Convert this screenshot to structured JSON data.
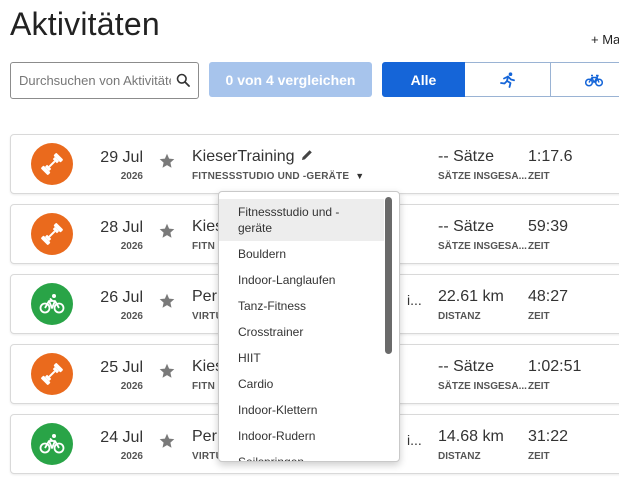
{
  "page": {
    "title": "Aktivitäten",
    "add_manual": "+ Ma"
  },
  "toolbar": {
    "search_placeholder": "Durchsuchen von Aktivitäten",
    "compare_label": "0 von 4 vergleichen",
    "filter_all_label": "Alle",
    "filter_icons": [
      "running-icon",
      "cycling-icon"
    ]
  },
  "colors": {
    "strength_icon_bg": "#ea6a1d",
    "cycling_icon_bg": "#29a447",
    "primary_blue": "#1565d8",
    "compare_disabled": "#a7c4ec"
  },
  "activities": [
    {
      "icon": "strength-icon",
      "day": "29 Jul",
      "year": "2026",
      "name": "KieserTraining",
      "type": "FITNESSSTUDIO UND -GERÄTE",
      "metric1_value": "-- Sätze",
      "metric1_label": "SÄTZE INSGESA...",
      "metric2_value": "1:17.6",
      "metric2_label": "ZEIT"
    },
    {
      "icon": "strength-icon",
      "day": "28 Jul",
      "year": "2026",
      "name": "Kies",
      "type": "FITN",
      "metric1_value": "-- Sätze",
      "metric1_label": "SÄTZE INSGESA...",
      "metric2_value": "59:39",
      "metric2_label": "ZEIT"
    },
    {
      "icon": "cycling-icon",
      "day": "26 Jul",
      "year": "2026",
      "name": "Per",
      "type": "VIRTU",
      "ellipsis": "i...",
      "metric1_value": "22.61 km",
      "metric1_label": "DISTANZ",
      "metric2_value": "48:27",
      "metric2_label": "ZEIT"
    },
    {
      "icon": "strength-icon",
      "day": "25 Jul",
      "year": "2026",
      "name": "Kies",
      "type": "FITN",
      "metric1_value": "-- Sätze",
      "metric1_label": "SÄTZE INSGESA...",
      "metric2_value": "1:02:51",
      "metric2_label": "ZEIT"
    },
    {
      "icon": "cycling-icon",
      "day": "24 Jul",
      "year": "2026",
      "name": "Per",
      "type": "VIRTU",
      "ellipsis": "i...",
      "metric1_value": "14.68 km",
      "metric1_label": "DISTANZ",
      "metric2_value": "31:22",
      "metric2_label": "ZEIT"
    }
  ],
  "type_dropdown": {
    "options": [
      "Fitnessstudio und -geräte",
      "Bouldern",
      "Indoor-Langlaufen",
      "Tanz-Fitness",
      "Crosstrainer",
      "HIIT",
      "Cardio",
      "Indoor-Klettern",
      "Indoor-Rudern",
      "Seilspringen"
    ],
    "highlighted": "Fitnessstudio und -geräte"
  }
}
